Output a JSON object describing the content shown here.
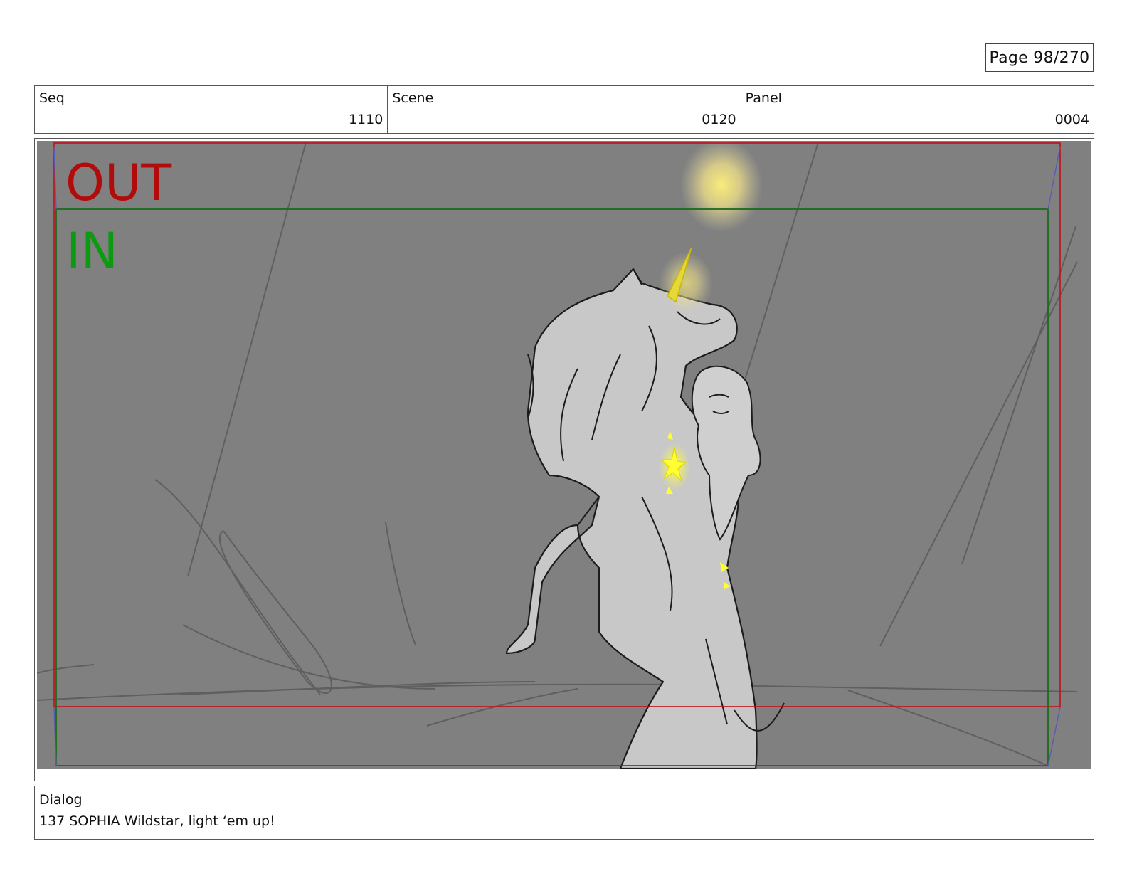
{
  "page": {
    "label": "Page",
    "number": "98/270",
    "text": "Page  98/270"
  },
  "meta": {
    "seq": {
      "label": "Seq",
      "value": "1110"
    },
    "scene": {
      "label": "Scene",
      "value": "0120"
    },
    "panel": {
      "label": "Panel",
      "value": "0004"
    }
  },
  "frame": {
    "out_label": "OUT",
    "in_label": "IN"
  },
  "colors": {
    "out": "#b10b0b",
    "in": "#0d9a12",
    "glow": "#fff06a",
    "bg": "#808080"
  },
  "dialog": {
    "label": "Dialog",
    "line": "137 SOPHIA Wildstar, light ‘em up!"
  }
}
